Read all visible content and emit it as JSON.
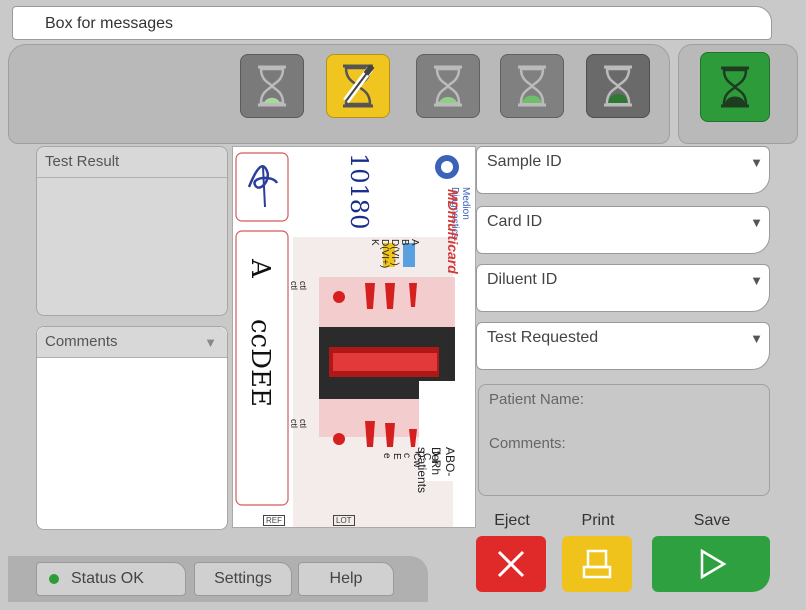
{
  "message_box": {
    "label": "Box for messages"
  },
  "steps": [
    {
      "name": "step-1",
      "color": "#7a7a7a"
    },
    {
      "name": "step-2",
      "color": "#f1c51f"
    },
    {
      "name": "step-3",
      "color": "#808080"
    },
    {
      "name": "step-4",
      "color": "#808080"
    },
    {
      "name": "step-5",
      "color": "#6a6a6a"
    }
  ],
  "panels": {
    "test_result": {
      "title": "Test Result"
    },
    "comments": {
      "title": "Comments"
    }
  },
  "fields": {
    "sample_id": "Sample ID",
    "card_id": "Card ID",
    "diluent_id": "Diluent ID",
    "test_requested": "Test Requested"
  },
  "info": {
    "patient_name": "Patient Name:",
    "comments": "Comments:"
  },
  "actions": {
    "eject": "Eject",
    "print": "Print",
    "save": "Save"
  },
  "tabs": {
    "status": "Status OK",
    "settings": "Settings",
    "help": "Help"
  },
  "card": {
    "number": "10180",
    "brand_line1": "Medion Diagnostics",
    "brand_line2": "MDmulticard",
    "product_line1": "ABO-D-Rh s",
    "product_line2": "for patients",
    "group": "A",
    "pheno": "ccDEE",
    "col_top": [
      "A",
      "B",
      "D(VI-)",
      "D(VI+)",
      "K"
    ],
    "col_bottom": [
      "C",
      "Cw",
      "c",
      "E",
      "e"
    ],
    "ctl_top": [
      "ctl",
      "ctl"
    ],
    "ctl_bottom": [
      "ctl",
      "ctl"
    ],
    "footer": [
      "REF",
      "LOT",
      ""
    ]
  },
  "colors": {
    "eject": "#e02a2a",
    "print": "#f0c21c",
    "save": "#2ea040",
    "status_dot": "#2e9b3b"
  }
}
